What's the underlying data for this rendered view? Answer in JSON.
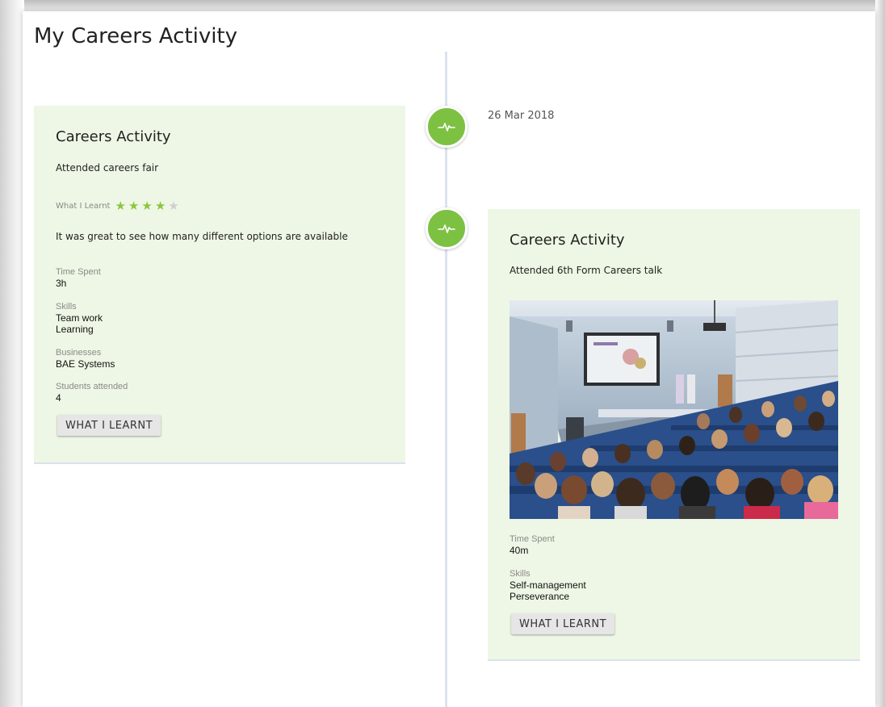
{
  "page": {
    "title": "My Careers Activity"
  },
  "timeline": {
    "date": "26 Mar 2018",
    "activity_icon": "pulse-icon",
    "accent_color": "#7dc142"
  },
  "cards": [
    {
      "title": "Careers Activity",
      "description": "Attended careers fair",
      "rating_label": "What I Learnt",
      "rating": 4,
      "rating_max": 5,
      "comment": "It was great to see how many different options are available",
      "fields": [
        {
          "label": "Time Spent",
          "values": [
            "3h"
          ]
        },
        {
          "label": "Skills",
          "values": [
            "Team work",
            "Learning"
          ]
        },
        {
          "label": "Businesses",
          "values": [
            "BAE Systems"
          ]
        },
        {
          "label": "Students attended",
          "values": [
            "4"
          ]
        }
      ],
      "button_label": "WHAT I LEARNT"
    },
    {
      "title": "Careers Activity",
      "description": "Attended 6th Form Careers talk",
      "image": "lecture-hall-photo",
      "fields": [
        {
          "label": "Time Spent",
          "values": [
            "40m"
          ]
        },
        {
          "label": "Skills",
          "values": [
            "Self-management",
            "Perseverance"
          ]
        }
      ],
      "button_label": "WHAT I LEARNT"
    }
  ],
  "colors": {
    "card_background": "#eef7e5",
    "star_on": "#8cc63f",
    "star_off": "#cfcfcf"
  }
}
